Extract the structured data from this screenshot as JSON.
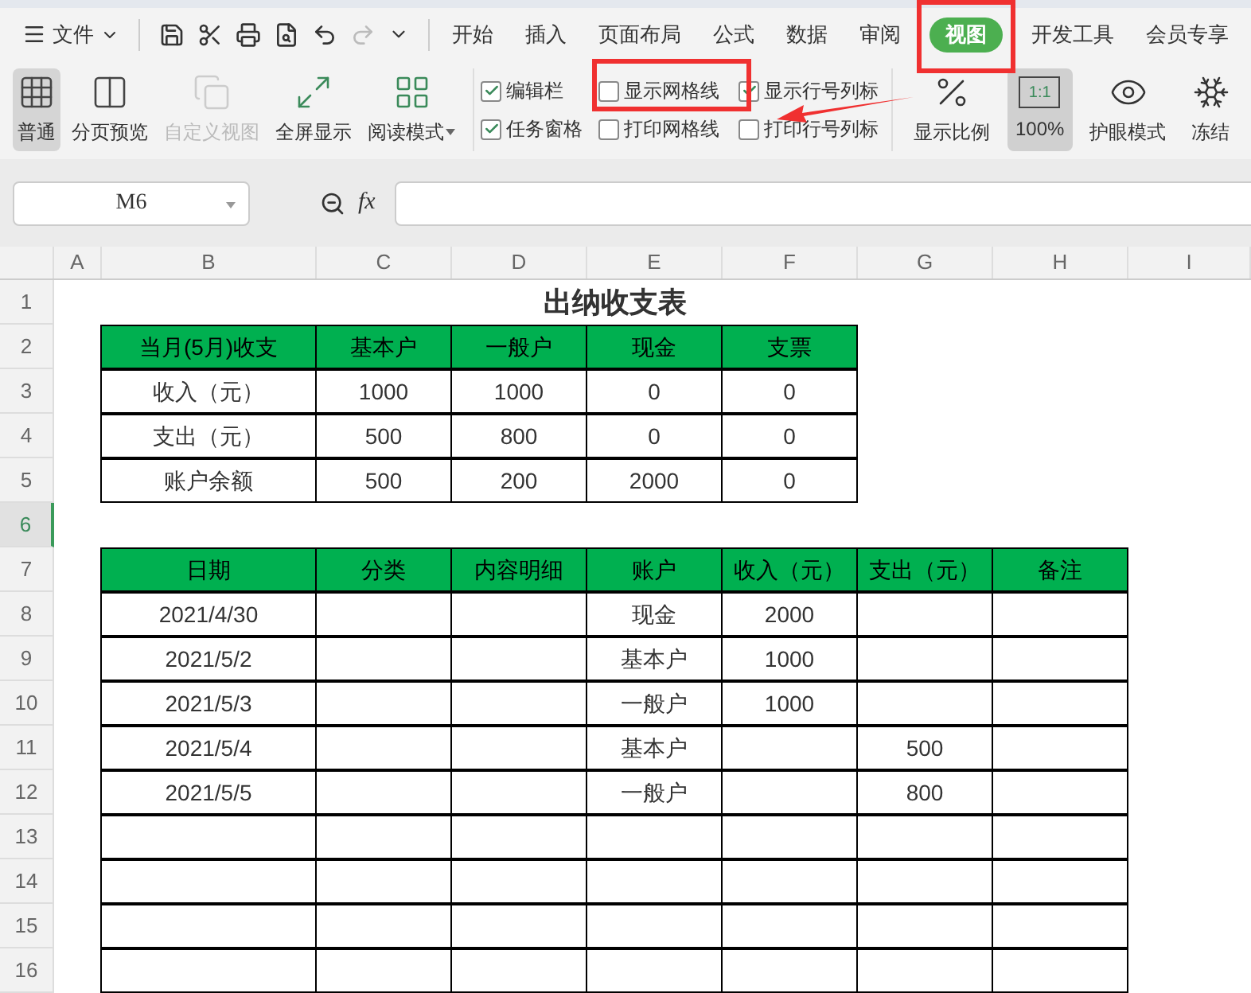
{
  "menu": {
    "file_label": "文件",
    "tabs": [
      {
        "label": "开始",
        "selected": false
      },
      {
        "label": "插入",
        "selected": false
      },
      {
        "label": "页面布局",
        "selected": false
      },
      {
        "label": "公式",
        "selected": false
      },
      {
        "label": "数据",
        "selected": false
      },
      {
        "label": "审阅",
        "selected": false
      },
      {
        "label": "视图",
        "selected": true
      },
      {
        "label": "开发工具",
        "selected": false
      },
      {
        "label": "会员专享",
        "selected": false
      }
    ]
  },
  "ribbon": {
    "view_buttons": [
      {
        "label": "普通",
        "selected": true,
        "disabled": false,
        "has_menu": false
      },
      {
        "label": "分页预览",
        "selected": false,
        "disabled": false,
        "has_menu": false
      },
      {
        "label": "自定义视图",
        "selected": false,
        "disabled": true,
        "has_menu": false
      },
      {
        "label": "全屏显示",
        "selected": false,
        "disabled": false,
        "has_menu": false
      },
      {
        "label": "阅读模式",
        "selected": false,
        "disabled": false,
        "has_menu": true
      }
    ],
    "checkboxes": [
      {
        "label": "编辑栏",
        "checked": true
      },
      {
        "label": "任务窗格",
        "checked": true
      },
      {
        "label": "显示网格线",
        "checked": false
      },
      {
        "label": "打印网格线",
        "checked": false
      },
      {
        "label": "显示行号列标",
        "checked": true
      },
      {
        "label": "打印行号列标",
        "checked": false
      }
    ],
    "zoom_buttons": [
      {
        "label": "显示比例",
        "selected": false
      },
      {
        "label": "100%",
        "selected": true,
        "icon_text": "1:1"
      },
      {
        "label": "护眼模式",
        "selected": false
      },
      {
        "label": "冻结",
        "selected": false
      }
    ]
  },
  "formula_bar": {
    "name_box": "M6",
    "fx": "fx"
  },
  "sheet": {
    "columns": [
      "A",
      "B",
      "C",
      "D",
      "E",
      "F",
      "G",
      "H",
      "I"
    ],
    "rows": [
      {
        "label": "1",
        "selected": false
      },
      {
        "label": "2",
        "selected": false
      },
      {
        "label": "3",
        "selected": false
      },
      {
        "label": "4",
        "selected": false
      },
      {
        "label": "5",
        "selected": false
      },
      {
        "label": "6",
        "selected": true
      },
      {
        "label": "7",
        "selected": false
      },
      {
        "label": "8",
        "selected": false
      },
      {
        "label": "9",
        "selected": false
      },
      {
        "label": "10",
        "selected": false
      },
      {
        "label": "11",
        "selected": false
      },
      {
        "label": "12",
        "selected": false
      },
      {
        "label": "13",
        "selected": false
      },
      {
        "label": "14",
        "selected": false
      },
      {
        "label": "15",
        "selected": false
      },
      {
        "label": "16",
        "selected": false
      }
    ],
    "title": "出纳收支表",
    "summary_table": {
      "columns": [
        "当月(5月)收支",
        "基本户",
        "一般户",
        "现金",
        "支票"
      ],
      "rows": [
        [
          "收入（元）",
          "1000",
          "1000",
          "0",
          "0"
        ],
        [
          "支出（元）",
          "500",
          "800",
          "0",
          "0"
        ],
        [
          "账户余额",
          "500",
          "200",
          "2000",
          "0"
        ]
      ]
    },
    "ledger_table": {
      "columns": [
        "日期",
        "分类",
        "内容明细",
        "账户",
        "收入（元）",
        "支出（元）",
        "备注"
      ],
      "rows": [
        [
          "2021/4/30",
          "",
          "",
          "现金",
          "2000",
          "",
          ""
        ],
        [
          "2021/5/2",
          "",
          "",
          "基本户",
          "1000",
          "",
          ""
        ],
        [
          "2021/5/3",
          "",
          "",
          "一般户",
          "1000",
          "",
          ""
        ],
        [
          "2021/5/4",
          "",
          "",
          "基本户",
          "",
          "500",
          ""
        ],
        [
          "2021/5/5",
          "",
          "",
          "一般户",
          "",
          "800",
          ""
        ]
      ]
    }
  }
}
